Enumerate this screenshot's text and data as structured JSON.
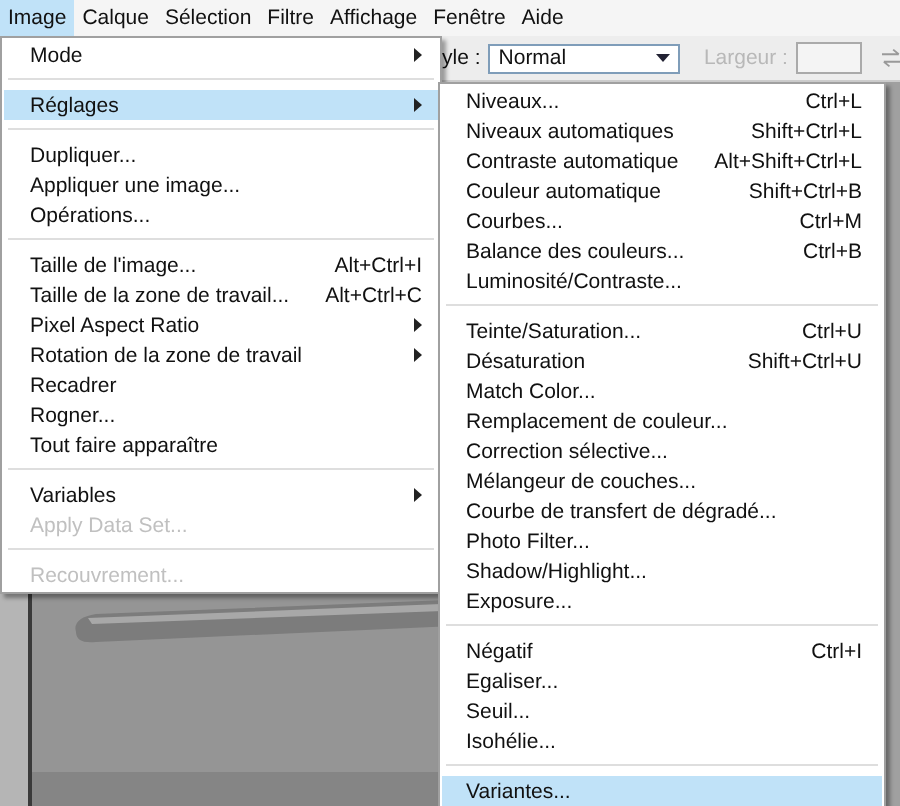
{
  "menubar": [
    {
      "label": "Image",
      "selected": true
    },
    {
      "label": "Calque",
      "selected": false
    },
    {
      "label": "Sélection",
      "selected": false
    },
    {
      "label": "Filtre",
      "selected": false
    },
    {
      "label": "Affichage",
      "selected": false
    },
    {
      "label": "Fenêtre",
      "selected": false
    },
    {
      "label": "Aide",
      "selected": false
    }
  ],
  "options_bar": {
    "style_label": "yle :",
    "style_value": "Normal",
    "width_label": "Largeur :",
    "width_disabled": true
  },
  "menu": [
    {
      "kind": "item",
      "label": "Mode",
      "submenu": true,
      "selected": false,
      "disabled": false
    },
    {
      "kind": "separator"
    },
    {
      "kind": "item",
      "label": "Réglages",
      "submenu": true,
      "selected": true,
      "disabled": false
    },
    {
      "kind": "separator"
    },
    {
      "kind": "item",
      "label": "Dupliquer...",
      "selected": false,
      "disabled": false
    },
    {
      "kind": "item",
      "label": "Appliquer une image...",
      "selected": false,
      "disabled": false
    },
    {
      "kind": "item",
      "label": "Opérations...",
      "selected": false,
      "disabled": false
    },
    {
      "kind": "separator"
    },
    {
      "kind": "item",
      "label": "Taille de l'image...",
      "shortcut": "Alt+Ctrl+I",
      "selected": false,
      "disabled": false
    },
    {
      "kind": "item",
      "label": "Taille de la zone de travail...",
      "shortcut": "Alt+Ctrl+C",
      "selected": false,
      "disabled": false
    },
    {
      "kind": "item",
      "label": "Pixel Aspect Ratio",
      "submenu": true,
      "selected": false,
      "disabled": false
    },
    {
      "kind": "item",
      "label": "Rotation de la zone de travail",
      "submenu": true,
      "selected": false,
      "disabled": false
    },
    {
      "kind": "item",
      "label": "Recadrer",
      "selected": false,
      "disabled": false
    },
    {
      "kind": "item",
      "label": "Rogner...",
      "selected": false,
      "disabled": false
    },
    {
      "kind": "item",
      "label": "Tout faire apparaître",
      "selected": false,
      "disabled": false
    },
    {
      "kind": "separator"
    },
    {
      "kind": "item",
      "label": "Variables",
      "submenu": true,
      "selected": false,
      "disabled": false
    },
    {
      "kind": "item",
      "label": "Apply Data Set...",
      "selected": false,
      "disabled": true
    },
    {
      "kind": "separator"
    },
    {
      "kind": "item",
      "label": "Recouvrement...",
      "selected": false,
      "disabled": true
    }
  ],
  "submenu": [
    {
      "kind": "item",
      "label": "Niveaux...",
      "shortcut": "Ctrl+L",
      "selected": false,
      "disabled": false
    },
    {
      "kind": "item",
      "label": "Niveaux automatiques",
      "shortcut": "Shift+Ctrl+L",
      "selected": false,
      "disabled": false
    },
    {
      "kind": "item",
      "label": "Contraste automatique",
      "shortcut": "Alt+Shift+Ctrl+L",
      "selected": false,
      "disabled": false
    },
    {
      "kind": "item",
      "label": "Couleur automatique",
      "shortcut": "Shift+Ctrl+B",
      "selected": false,
      "disabled": false
    },
    {
      "kind": "item",
      "label": "Courbes...",
      "shortcut": "Ctrl+M",
      "selected": false,
      "disabled": false
    },
    {
      "kind": "item",
      "label": "Balance des couleurs...",
      "shortcut": "Ctrl+B",
      "selected": false,
      "disabled": false
    },
    {
      "kind": "item",
      "label": "Luminosité/Contraste...",
      "selected": false,
      "disabled": false
    },
    {
      "kind": "separator"
    },
    {
      "kind": "item",
      "label": "Teinte/Saturation...",
      "shortcut": "Ctrl+U",
      "selected": false,
      "disabled": false
    },
    {
      "kind": "item",
      "label": "Désaturation",
      "shortcut": "Shift+Ctrl+U",
      "selected": false,
      "disabled": false
    },
    {
      "kind": "item",
      "label": "Match Color...",
      "selected": false,
      "disabled": false
    },
    {
      "kind": "item",
      "label": "Remplacement de couleur...",
      "selected": false,
      "disabled": false
    },
    {
      "kind": "item",
      "label": "Correction sélective...",
      "selected": false,
      "disabled": false
    },
    {
      "kind": "item",
      "label": "Mélangeur de couches...",
      "selected": false,
      "disabled": false
    },
    {
      "kind": "item",
      "label": "Courbe de transfert de dégradé...",
      "selected": false,
      "disabled": false
    },
    {
      "kind": "item",
      "label": "Photo Filter...",
      "selected": false,
      "disabled": false
    },
    {
      "kind": "item",
      "label": "Shadow/Highlight...",
      "selected": false,
      "disabled": false
    },
    {
      "kind": "item",
      "label": "Exposure...",
      "selected": false,
      "disabled": false
    },
    {
      "kind": "separator"
    },
    {
      "kind": "item",
      "label": "Négatif",
      "shortcut": "Ctrl+I",
      "selected": false,
      "disabled": false
    },
    {
      "kind": "item",
      "label": "Egaliser...",
      "selected": false,
      "disabled": false
    },
    {
      "kind": "item",
      "label": "Seuil...",
      "selected": false,
      "disabled": false
    },
    {
      "kind": "item",
      "label": "Isohélie...",
      "selected": false,
      "disabled": false
    },
    {
      "kind": "separator"
    },
    {
      "kind": "item",
      "label": "Variantes...",
      "selected": true,
      "disabled": false
    }
  ]
}
